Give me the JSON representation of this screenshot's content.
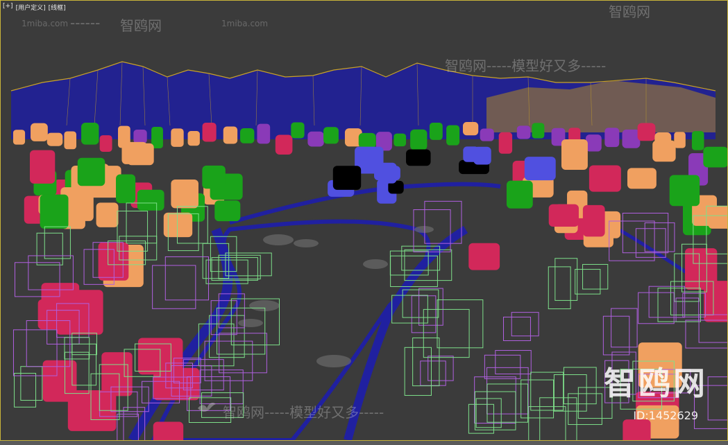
{
  "viewport": {
    "labels": [
      "[+]",
      "[用户定义]",
      "[线框]"
    ],
    "border_color": "#c8b43a",
    "background_color": "#3b3b3b"
  },
  "watermarks": {
    "top_url_left": "1miba.com",
    "top_dashes_left": "------",
    "top_brand_1": "智鸥网",
    "top_url_right": "1miba.com",
    "top_brand_2": "智鸥网",
    "mid_brand": "智鸥网-----模型好又多-----",
    "bottom_brand": "智鸥网-----模型好又多-----",
    "logo": "智鸥网",
    "id": "ID:1452629"
  },
  "colors": {
    "terrain": "#c9a227",
    "terrain_grid": "#1f1fa0",
    "green": "#1aa31a",
    "orange": "#f0a060",
    "pink": "#d2285a",
    "purple": "#8a3ab8",
    "blue": "#5050e0",
    "wire_green": "#7ee08a",
    "wire_purple": "#b060e0",
    "road": "#2020a0"
  }
}
